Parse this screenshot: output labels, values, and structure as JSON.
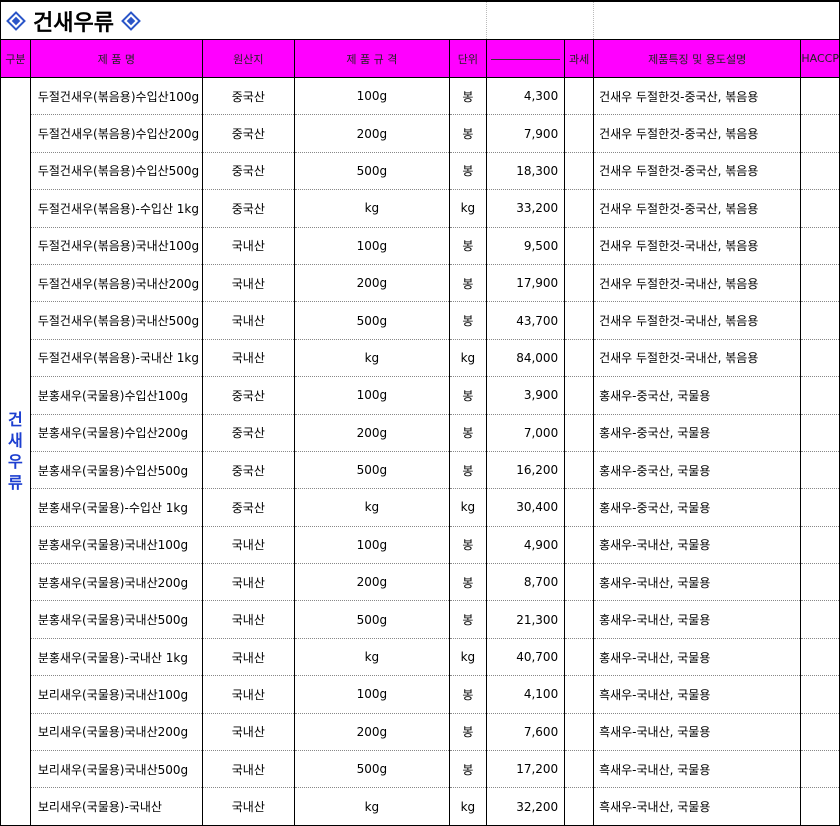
{
  "title": "건새우류",
  "headers": {
    "category": "구분",
    "name": "제 품 명",
    "origin": "원산지",
    "spec": "제 품 규 격",
    "unit": "단위",
    "price": "",
    "tax": "과세",
    "desc": "제품특징 및 용도설명",
    "haccp": "HACCP"
  },
  "category_label": "건새우류",
  "rows": [
    {
      "name": "두절건새우(볶음용)수입산100g",
      "origin": "중국산",
      "spec": "100g",
      "unit": "봉",
      "price": "4,300",
      "desc": "건새우 두절한것-중국산, 볶음용"
    },
    {
      "name": "두절건새우(볶음용)수입산200g",
      "origin": "중국산",
      "spec": "200g",
      "unit": "봉",
      "price": "7,900",
      "desc": "건새우 두절한것-중국산, 볶음용"
    },
    {
      "name": "두절건새우(볶음용)수입산500g",
      "origin": "중국산",
      "spec": "500g",
      "unit": "봉",
      "price": "18,300",
      "desc": "건새우 두절한것-중국산, 볶음용"
    },
    {
      "name": "두절건새우(볶음용)-수입산 1kg",
      "origin": "중국산",
      "spec": "kg",
      "unit": "kg",
      "price": "33,200",
      "desc": "건새우 두절한것-중국산, 볶음용"
    },
    {
      "name": "두절건새우(볶음용)국내산100g",
      "origin": "국내산",
      "spec": "100g",
      "unit": "봉",
      "price": "9,500",
      "desc": "건새우 두절한것-국내산, 볶음용"
    },
    {
      "name": "두절건새우(볶음용)국내산200g",
      "origin": "국내산",
      "spec": "200g",
      "unit": "봉",
      "price": "17,900",
      "desc": "건새우 두절한것-국내산, 볶음용"
    },
    {
      "name": "두절건새우(볶음용)국내산500g",
      "origin": "국내산",
      "spec": "500g",
      "unit": "봉",
      "price": "43,700",
      "desc": "건새우 두절한것-국내산, 볶음용"
    },
    {
      "name": "두절건새우(볶음용)-국내산 1kg",
      "origin": "국내산",
      "spec": "kg",
      "unit": "kg",
      "price": "84,000",
      "desc": "건새우 두절한것-국내산, 볶음용"
    },
    {
      "name": "분홍새우(국물용)수입산100g",
      "origin": "중국산",
      "spec": "100g",
      "unit": "봉",
      "price": "3,900",
      "desc": "홍새우-중국산, 국물용"
    },
    {
      "name": "분홍새우(국물용)수입산200g",
      "origin": "중국산",
      "spec": "200g",
      "unit": "봉",
      "price": "7,000",
      "desc": "홍새우-중국산, 국물용"
    },
    {
      "name": "분홍새우(국물용)수입산500g",
      "origin": "중국산",
      "spec": "500g",
      "unit": "봉",
      "price": "16,200",
      "desc": "홍새우-중국산, 국물용"
    },
    {
      "name": "분홍새우(국물용)-수입산 1kg",
      "origin": "중국산",
      "spec": "kg",
      "unit": "kg",
      "price": "30,400",
      "desc": "홍새우-중국산, 국물용"
    },
    {
      "name": "분홍새우(국물용)국내산100g",
      "origin": "국내산",
      "spec": "100g",
      "unit": "봉",
      "price": "4,900",
      "desc": "홍새우-국내산, 국물용"
    },
    {
      "name": "분홍새우(국물용)국내산200g",
      "origin": "국내산",
      "spec": "200g",
      "unit": "봉",
      "price": "8,700",
      "desc": "홍새우-국내산, 국물용"
    },
    {
      "name": "분홍새우(국물용)국내산500g",
      "origin": "국내산",
      "spec": "500g",
      "unit": "봉",
      "price": "21,300",
      "desc": "홍새우-국내산, 국물용"
    },
    {
      "name": "분홍새우(국물용)-국내산 1kg",
      "origin": "국내산",
      "spec": "kg",
      "unit": "kg",
      "price": "40,700",
      "desc": "홍새우-국내산, 국물용"
    },
    {
      "name": "보리새우(국물용)국내산100g",
      "origin": "국내산",
      "spec": "100g",
      "unit": "봉",
      "price": "4,100",
      "desc": "흑새우-국내산, 국물용"
    },
    {
      "name": "보리새우(국물용)국내산200g",
      "origin": "국내산",
      "spec": "200g",
      "unit": "봉",
      "price": "7,600",
      "desc": "흑새우-국내산, 국물용"
    },
    {
      "name": "보리새우(국물용)국내산500g",
      "origin": "국내산",
      "spec": "500g",
      "unit": "봉",
      "price": "17,200",
      "desc": "흑새우-국내산, 국물용"
    },
    {
      "name": "보리새우(국물용)-국내산",
      "origin": "국내산",
      "spec": "kg",
      "unit": "kg",
      "price": "32,200",
      "desc": "흑새우-국내산, 국물용"
    }
  ],
  "colors": {
    "header_bg": "#ff00ff",
    "price_text": "#ff0000",
    "category_text": "#1d3fd0",
    "title_diamond": "#2a55c8"
  }
}
